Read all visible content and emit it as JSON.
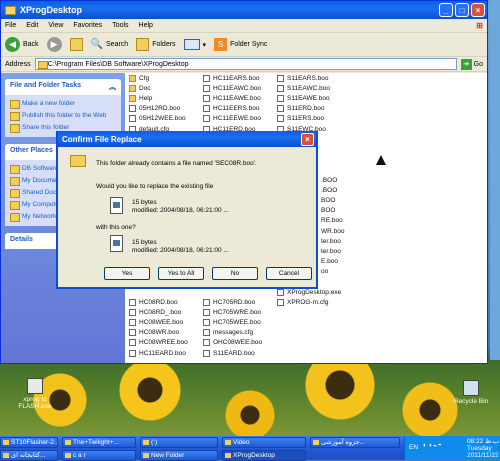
{
  "window": {
    "title": "XProgDesktop"
  },
  "menu": [
    "File",
    "Edit",
    "View",
    "Favorites",
    "Tools",
    "Help"
  ],
  "toolbar": {
    "back": "Back",
    "search": "Search",
    "folders": "Folders",
    "foldersync": "Folder Sync"
  },
  "address": {
    "label": "Address",
    "value": "C:\\Program Files\\DB Software\\XProgDesktop",
    "go": "Go"
  },
  "taskpane": {
    "file_tasks": {
      "title": "File and Folder Tasks",
      "items": [
        "Make a new folder",
        "Publish this folder to the Web",
        "Share this folder"
      ]
    },
    "other_places": {
      "title": "Other Places",
      "items": [
        "DB Software",
        "My Documents",
        "Shared Documents",
        "My Computer",
        "My Network Places"
      ]
    },
    "details": {
      "title": "Details"
    }
  },
  "files": {
    "col1": [
      "Cfg",
      "Doc",
      "Help",
      "05H12RD.boo",
      "05H12WEE.boo",
      "default.cfg",
      "",
      "",
      "",
      "",
      "",
      "",
      "",
      "",
      "",
      "",
      "",
      "",
      "",
      "",
      "",
      "",
      "HC08RD.boo",
      "HC08RD_.boo",
      "HC08WEE.boo",
      "HC08WR.boo",
      "HC08WREE.boo",
      "HC11EARD.boo"
    ],
    "col2": [
      "HC11EARS.boo",
      "HC11EAWC.boo",
      "HC11EAWE.boo",
      "HC11EERS.boo",
      "HC11EEWE.boo",
      "HC11ERD.boo",
      "",
      "",
      "",
      "",
      "",
      "",
      "",
      "",
      "",
      "",
      "",
      "",
      "",
      "",
      "",
      "",
      "HC705RD.boo",
      "HC705WRE.boo",
      "HC705WEE.boo",
      "messages.cfg",
      "OHC08WEE.boo",
      "S11EARD.boo"
    ],
    "col3": [
      "S11EARS.boo",
      "S11EAWC.boo",
      "S11EAWE.boo",
      "S11ERD.boo",
      "S11ERS.boo",
      "S11EWC.boo",
      "",
      "",
      "",
      "",
      "",
      "",
      "",
      "",
      "",
      "",
      "",
      "",
      "",
      "",
      "XProg.dev",
      "XProgDesktop.exe",
      "XPROG-m.cfg"
    ],
    "col3_partial": [
      ".BOO",
      ".BOO",
      "BOO",
      "BOO",
      "RE.boo",
      "WR.boo",
      "ter.boo",
      "ter.boo",
      "E.boo",
      "oo"
    ]
  },
  "dialog": {
    "title": "Confirm File Replace",
    "message": "This folder already contains a file named 'SEC08R.boo'.",
    "question": "Would you like to replace the existing file",
    "existing": {
      "size": "15 bytes",
      "modified": "modified: 2004/08/18, 06:21:00 ..."
    },
    "with_label": "with this one?",
    "new": {
      "size": "15 bytes",
      "modified": "modified: 2004/08/18, 06:21:00 ..."
    },
    "buttons": {
      "yes": "Yes",
      "yes_all": "Yes to All",
      "no": "No",
      "cancel": "Cancel"
    }
  },
  "desktop": {
    "icon1": "xprog to FLASH.exe",
    "icon1_prefix": "ST10",
    "recycle": "Recycle Bin"
  },
  "taskbar": {
    "tasks": [
      "ST10Flasher-2...",
      "The+Twilight+...",
      "(:)",
      "Video",
      "جزوه آموزشی...",
      "کتابخانه ای...",
      "c a r",
      "New Folder",
      "XProgDesktop"
    ],
    "lang": "EN",
    "time": "08:22 ب.ظ",
    "day": "Tuesday",
    "date": "2011/11/22"
  }
}
